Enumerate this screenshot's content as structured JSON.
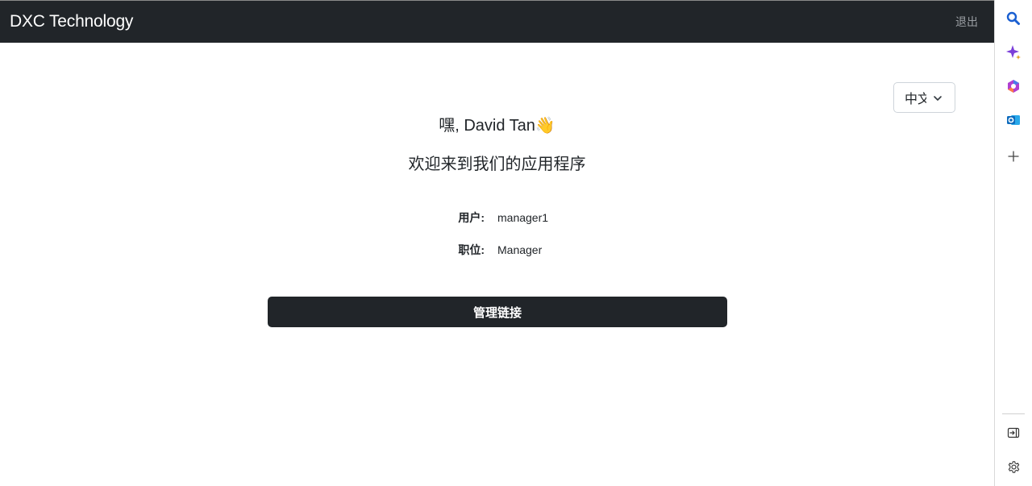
{
  "navbar": {
    "brand": "DXC Technology",
    "logout": "退出"
  },
  "language": {
    "selected": "中文"
  },
  "greeting": {
    "text": "嘿, David Tan",
    "emoji": "👋"
  },
  "welcome": "欢迎来到我们的应用程序",
  "user_info": {
    "user_label": "用户:",
    "user_value": "manager1",
    "role_label": "职位:",
    "role_value": "Manager"
  },
  "main_button": {
    "label": "管理链接"
  },
  "sidebar": {
    "icons": [
      "search-icon",
      "copilot-sparkle-icon",
      "office-icon",
      "outlook-icon",
      "add-icon",
      "sidebar-toggle-icon",
      "settings-icon"
    ]
  }
}
